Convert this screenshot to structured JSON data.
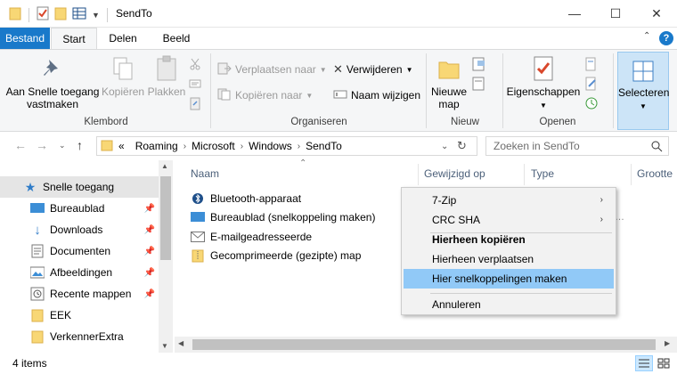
{
  "window": {
    "title": "SendTo",
    "controls": {
      "minimize": "—",
      "maximize": "☐",
      "close": "✕"
    }
  },
  "ribbon": {
    "tabs": [
      {
        "label": "Bestand"
      },
      {
        "label": "Start"
      },
      {
        "label": "Delen"
      },
      {
        "label": "Beeld"
      }
    ],
    "help_label": "?",
    "groups": {
      "klembord": {
        "label": "Klembord",
        "pin_label": "Aan Snelle toegang vastmaken",
        "copy_label": "Kopiëren",
        "paste_label": "Plakken"
      },
      "organiseren": {
        "label": "Organiseren",
        "move_to_label": "Verplaatsen naar",
        "copy_to_label": "Kopiëren naar",
        "delete_label": "Verwijderen",
        "rename_label": "Naam wijzigen"
      },
      "nieuw": {
        "label": "Nieuw",
        "new_folder_label": "Nieuwe map"
      },
      "openen": {
        "label": "Openen",
        "properties_label": "Eigenschappen"
      },
      "selecteren": {
        "select_label": "Selecteren"
      }
    }
  },
  "address": {
    "prefix": "«",
    "crumbs": [
      "Roaming",
      "Microsoft",
      "Windows",
      "SendTo"
    ],
    "search_placeholder": "Zoeken in SendTo"
  },
  "nav": {
    "items": [
      {
        "label": "Snelle toegang",
        "icon": "star-icon",
        "selected": true,
        "pinned": false
      },
      {
        "label": "Bureaublad",
        "icon": "desktop-icon",
        "pinned": true
      },
      {
        "label": "Downloads",
        "icon": "download-icon",
        "pinned": true
      },
      {
        "label": "Documenten",
        "icon": "document-icon",
        "pinned": true
      },
      {
        "label": "Afbeeldingen",
        "icon": "pictures-icon",
        "pinned": true
      },
      {
        "label": "Recente mappen",
        "icon": "recent-folder-icon",
        "pinned": true
      },
      {
        "label": "EEK",
        "icon": "folder-icon",
        "pinned": false
      },
      {
        "label": "VerkennerExtra",
        "icon": "folder-icon",
        "pinned": false
      }
    ]
  },
  "filelist": {
    "columns": [
      "Naam",
      "Gewijzigd op",
      "Type",
      "Grootte"
    ],
    "rows": [
      {
        "name": "Bluetooth-apparaat",
        "icon": "bluetooth-icon"
      },
      {
        "name": "Bureaublad (snelkoppeling maken)",
        "icon": "desktop-icon"
      },
      {
        "name": "E-mailgeadresseerde",
        "icon": "mail-icon"
      },
      {
        "name": "Gecomprimeerde (gezipte) map",
        "icon": "zip-folder-icon"
      }
    ]
  },
  "context_menu": {
    "items": [
      {
        "label": "7-Zip",
        "submenu": true
      },
      {
        "label": "CRC SHA",
        "submenu": true
      },
      {
        "label": "Hierheen kopiëren",
        "bold": true
      },
      {
        "label": "Hierheen verplaatsen"
      },
      {
        "label": "Hier snelkoppelingen maken",
        "highlighted": true
      },
      {
        "label": "Annuleren"
      }
    ]
  },
  "status": {
    "item_count": "4 items"
  },
  "colors": {
    "accent": "#1979ca",
    "highlight": "#91c9f7",
    "selection": "#cce4f7"
  }
}
